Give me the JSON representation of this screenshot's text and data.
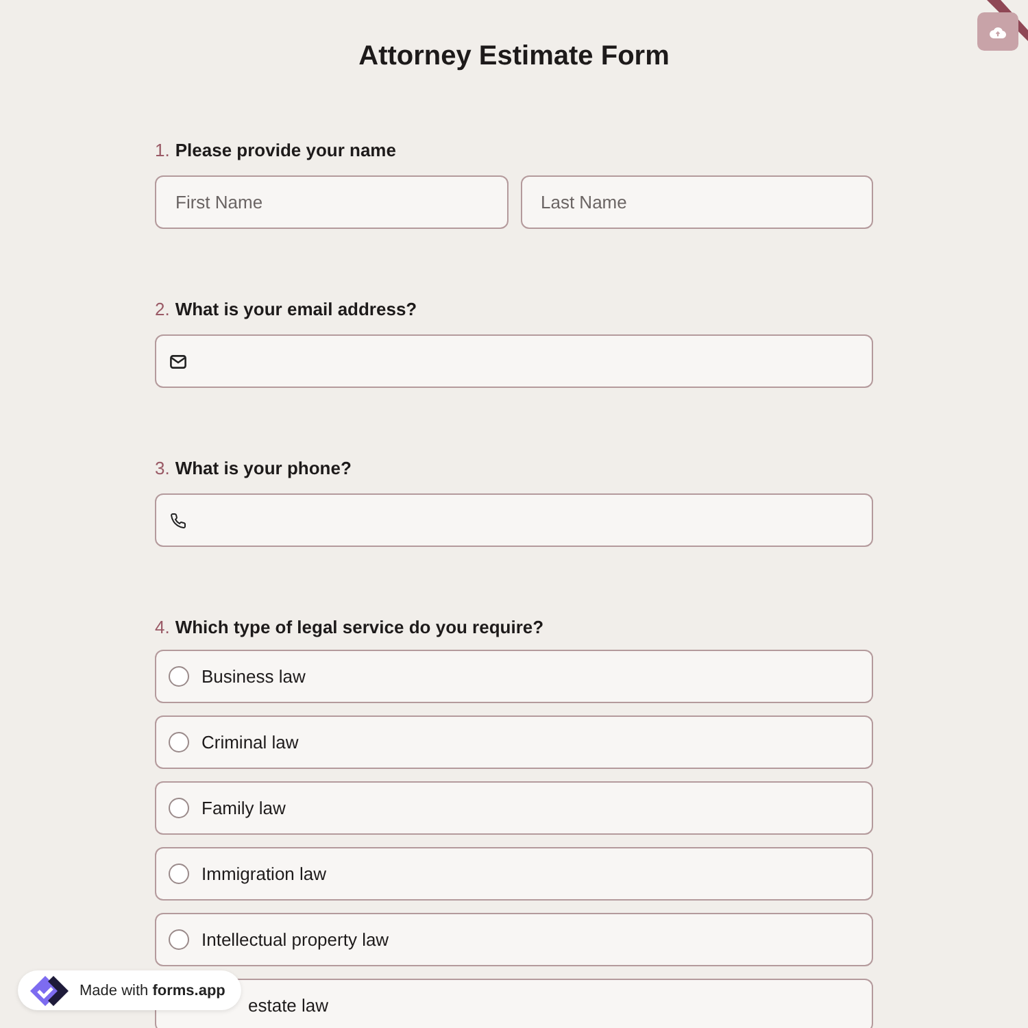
{
  "title": "Attorney Estimate Form",
  "questions": [
    {
      "number": "1.",
      "label": "Please provide your name",
      "kind": "name",
      "fields": [
        {
          "placeholder": "First Name"
        },
        {
          "placeholder": "Last Name"
        }
      ]
    },
    {
      "number": "2.",
      "label": "What is your email address?",
      "kind": "email"
    },
    {
      "number": "3.",
      "label": "What is your phone?",
      "kind": "phone"
    },
    {
      "number": "4.",
      "label": "Which type of legal service do you require?",
      "kind": "choice",
      "options": [
        {
          "label": "Business law",
          "selected": false
        },
        {
          "label": "Criminal law",
          "selected": false
        },
        {
          "label": "Family law",
          "selected": false
        },
        {
          "label": "Immigration law",
          "selected": false
        },
        {
          "label": "Intellectual property law",
          "selected": false
        },
        {
          "label": "estate law",
          "selected": false,
          "partly_hidden": true
        }
      ]
    }
  ],
  "badge": {
    "prefix": "Made with",
    "brand": "forms.app"
  }
}
